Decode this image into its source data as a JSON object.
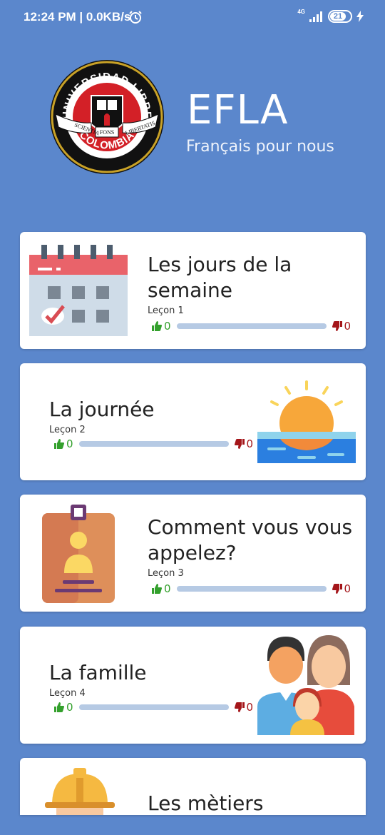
{
  "status_bar": {
    "time": "12:24 PM | 0.0KB/s",
    "network": "4G",
    "battery": "21"
  },
  "header": {
    "title": "EFLA",
    "subtitle": "Français pour nous",
    "logo": {
      "top_text": "UNIVERSIDAD LIBRE",
      "bottom_text": "COLOMBIA",
      "ribbon_left": "SCIENTIA",
      "ribbon_center": "FONS",
      "ribbon_right": "LIBERTATIS"
    }
  },
  "lessons": [
    {
      "title_line1": "Les jours de la",
      "title_line2": "semaine",
      "lesson_label": "Leçon 1",
      "likes": "0",
      "dislikes": "0",
      "icon": "calendar-icon"
    },
    {
      "title_line1": "La journée",
      "title_line2": "",
      "lesson_label": "Leçon 2",
      "likes": "0",
      "dislikes": "0",
      "icon": "sunset-icon"
    },
    {
      "title_line1": "Comment vous vous",
      "title_line2": "appelez?",
      "lesson_label": "Leçon 3",
      "likes": "0",
      "dislikes": "0",
      "icon": "id-badge-icon"
    },
    {
      "title_line1": "La famille",
      "title_line2": "",
      "lesson_label": "Leçon 4",
      "likes": "0",
      "dislikes": "0",
      "icon": "family-icon"
    },
    {
      "title_line1": "Les mètiers",
      "title_line2": "",
      "icon": "hard-hat-icon"
    }
  ],
  "colors": {
    "background": "#5b87cc",
    "like": "#33a02c",
    "dislike": "#a4161a",
    "progress_track": "#b6cae4"
  }
}
